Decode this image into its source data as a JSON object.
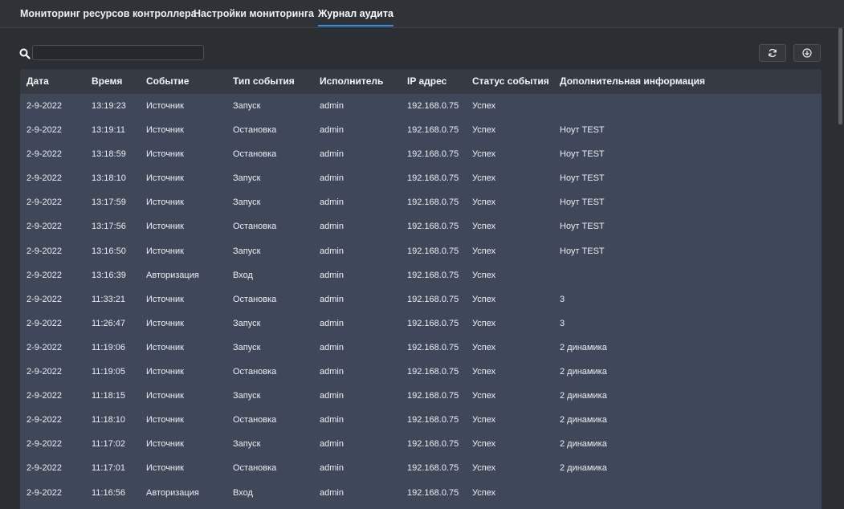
{
  "tabs": [
    {
      "label": "Мониторинг ресурсов контроллера",
      "active": false
    },
    {
      "label": "Настройки мониторинга",
      "active": false
    },
    {
      "label": "Журнал аудита",
      "active": true
    }
  ],
  "search": {
    "placeholder": "",
    "value": ""
  },
  "toolbar": {
    "refresh_icon": "refresh-icon",
    "download_icon": "download-icon"
  },
  "table": {
    "columns": [
      "Дата",
      "Время",
      "Событие",
      "Тип события",
      "Исполнитель",
      "IP адрес",
      "Статус события",
      "Дополнительная информация"
    ],
    "rows": [
      [
        "2-9-2022",
        "13:19:23",
        "Источник",
        "Запуск",
        "admin",
        "192.168.0.75",
        "Успех",
        ""
      ],
      [
        "2-9-2022",
        "13:19:11",
        "Источник",
        "Остановка",
        "admin",
        "192.168.0.75",
        "Успех",
        "Ноут TEST"
      ],
      [
        "2-9-2022",
        "13:18:59",
        "Источник",
        "Остановка",
        "admin",
        "192.168.0.75",
        "Успех",
        "Ноут TEST"
      ],
      [
        "2-9-2022",
        "13:18:10",
        "Источник",
        "Запуск",
        "admin",
        "192.168.0.75",
        "Успех",
        "Ноут TEST"
      ],
      [
        "2-9-2022",
        "13:17:59",
        "Источник",
        "Запуск",
        "admin",
        "192.168.0.75",
        "Успех",
        "Ноут TEST"
      ],
      [
        "2-9-2022",
        "13:17:56",
        "Источник",
        "Остановка",
        "admin",
        "192.168.0.75",
        "Успех",
        "Ноут TEST"
      ],
      [
        "2-9-2022",
        "13:16:50",
        "Источник",
        "Запуск",
        "admin",
        "192.168.0.75",
        "Успех",
        "Ноут TEST"
      ],
      [
        "2-9-2022",
        "13:16:39",
        "Авторизация",
        "Вход",
        "admin",
        "192.168.0.75",
        "Успех",
        ""
      ],
      [
        "2-9-2022",
        "11:33:21",
        "Источник",
        "Остановка",
        "admin",
        "192.168.0.75",
        "Успех",
        "3"
      ],
      [
        "2-9-2022",
        "11:26:47",
        "Источник",
        "Запуск",
        "admin",
        "192.168.0.75",
        "Успех",
        "3"
      ],
      [
        "2-9-2022",
        "11:19:06",
        "Источник",
        "Запуск",
        "admin",
        "192.168.0.75",
        "Успех",
        "2 динамика"
      ],
      [
        "2-9-2022",
        "11:19:05",
        "Источник",
        "Остановка",
        "admin",
        "192.168.0.75",
        "Успех",
        "2 динамика"
      ],
      [
        "2-9-2022",
        "11:18:15",
        "Источник",
        "Запуск",
        "admin",
        "192.168.0.75",
        "Успех",
        "2 динамика"
      ],
      [
        "2-9-2022",
        "11:18:10",
        "Источник",
        "Остановка",
        "admin",
        "192.168.0.75",
        "Успех",
        "2 динамика"
      ],
      [
        "2-9-2022",
        "11:17:02",
        "Источник",
        "Запуск",
        "admin",
        "192.168.0.75",
        "Успех",
        "2 динамика"
      ],
      [
        "2-9-2022",
        "11:17:01",
        "Источник",
        "Остановка",
        "admin",
        "192.168.0.75",
        "Успех",
        "2 динамика"
      ],
      [
        "2-9-2022",
        "11:16:56",
        "Авторизация",
        "Вход",
        "admin",
        "192.168.0.75",
        "Успех",
        ""
      ]
    ]
  },
  "colors": {
    "background": "#2b2e33",
    "table_body": "#3f4859",
    "table_header": "#353a43",
    "accent": "#3a8fd8"
  }
}
